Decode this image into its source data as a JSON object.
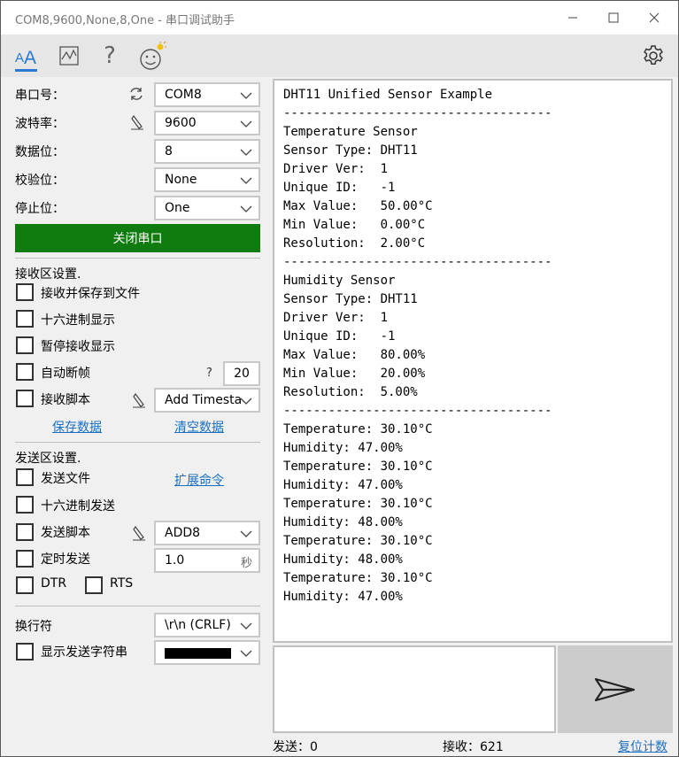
{
  "window": {
    "title": "COM8,9600,None,8,One - 串口调试助手",
    "minimize_glyph": "—",
    "maximize_glyph": "☐",
    "close_glyph": "✕"
  },
  "toolbar": {
    "icons": [
      "font-size-icon",
      "chart-icon",
      "help-icon",
      "smiley-icon",
      "gear-icon"
    ],
    "help_glyph": "?",
    "accent": "#2a78d2"
  },
  "serial": {
    "port_label": "串口号：",
    "port_value": "COM8",
    "baud_label": "波特率：",
    "baud_value": "9600",
    "databits_label": "数据位：",
    "databits_value": "8",
    "parity_label": "校验位：",
    "parity_value": "None",
    "stopbits_label": "停止位：",
    "stopbits_value": "One",
    "toggle_button": "关闭串口",
    "toggle_button_color": "#107c10"
  },
  "receive": {
    "section_title": "接收区设置.",
    "save_to_file": "接收并保存到文件",
    "hex_display": "十六进制显示",
    "pause_display": "暂停接收显示",
    "auto_frame": "自动断帧",
    "auto_frame_help": "?",
    "auto_frame_value": "20",
    "script": "接收脚本",
    "script_value": "Add Timesta",
    "save_data": "保存数据",
    "clear_data": "清空数据"
  },
  "send": {
    "section_title": "发送区设置.",
    "send_file": "发送文件",
    "extend_cmd": "扩展命令",
    "hex_send": "十六进制发送",
    "script": "发送脚本",
    "script_value": "ADD8",
    "timed_send": "定时发送",
    "timed_value": "1.0",
    "timed_unit": "秒",
    "dtr": "DTR",
    "rts": "RTS",
    "newline_label": "换行符",
    "newline_value": "\\r\\n (CRLF)",
    "show_send_string": "显示发送字符串"
  },
  "output": {
    "lines": [
      "DHT11 Unified Sensor Example",
      "------------------------------------",
      "Temperature Sensor",
      "Sensor Type: DHT11",
      "Driver Ver:  1",
      "Unique ID:   -1",
      "Max Value:   50.00°C",
      "Min Value:   0.00°C",
      "Resolution:  2.00°C",
      "------------------------------------",
      "Humidity Sensor",
      "Sensor Type: DHT11",
      "Driver Ver:  1",
      "Unique ID:   -1",
      "Max Value:   80.00%",
      "Min Value:   20.00%",
      "Resolution:  5.00%",
      "------------------------------------",
      "Temperature: 30.10°C",
      "Humidity: 47.00%",
      "Temperature: 30.10°C",
      "Humidity: 47.00%",
      "Temperature: 30.10°C",
      "Humidity: 48.00%",
      "Temperature: 30.10°C",
      "Humidity: 48.00%",
      "Temperature: 30.10°C",
      "Humidity: 47.00%"
    ]
  },
  "status": {
    "sent": "发送：0",
    "received": "接收：621",
    "reset": "复位计数"
  }
}
